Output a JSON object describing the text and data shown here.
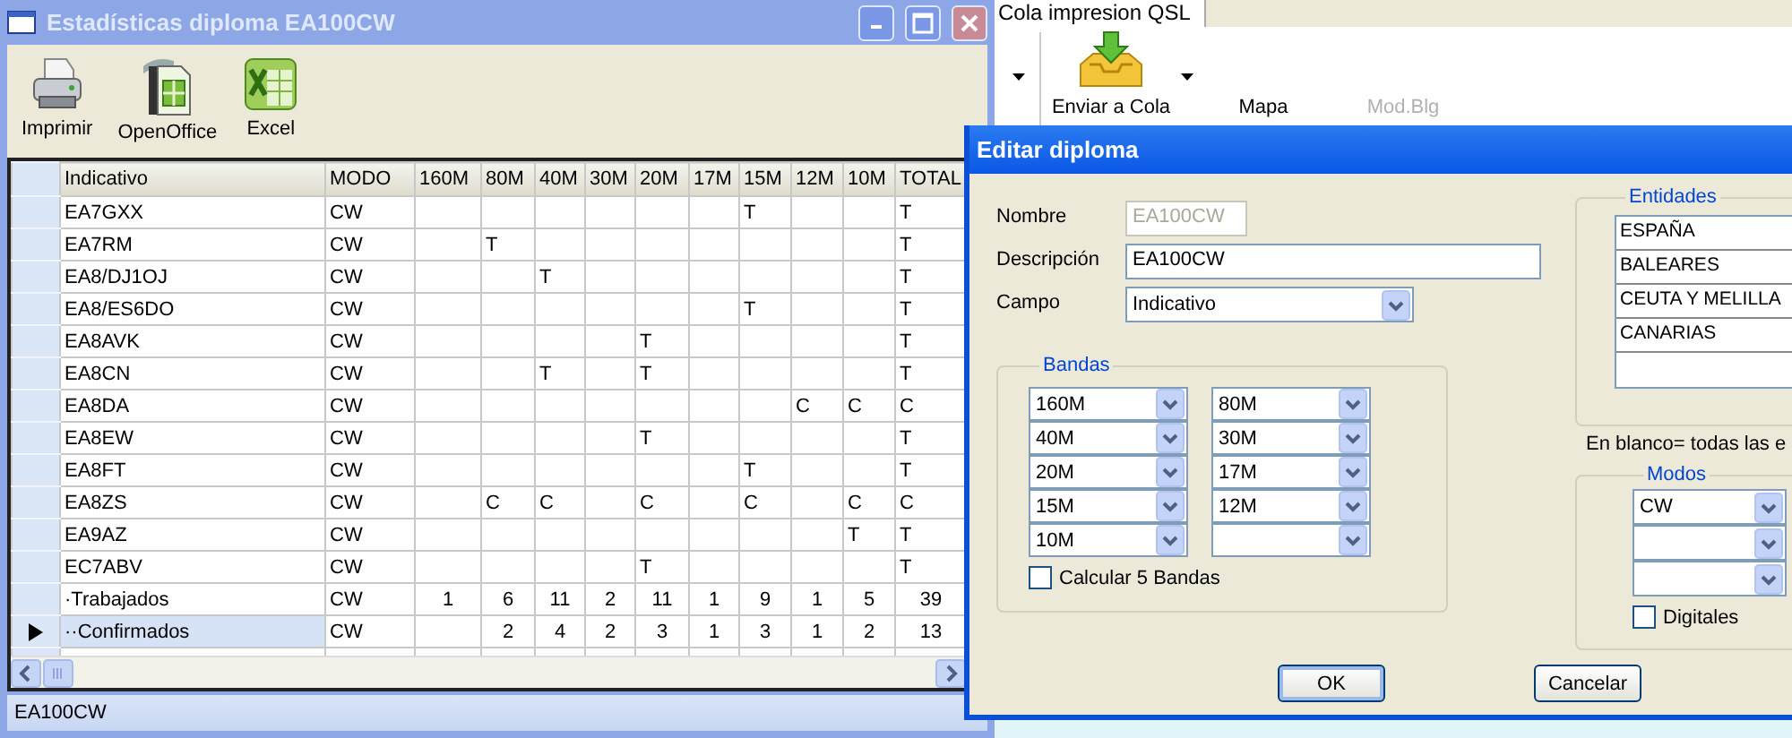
{
  "stats_window": {
    "title": "Estadísticas diploma EA100CW",
    "toolbar": [
      {
        "label": "Imprimir",
        "kind": "printer"
      },
      {
        "label": "OpenOffice",
        "kind": "openoffice"
      },
      {
        "label": "Excel",
        "kind": "excel"
      }
    ],
    "table": {
      "columns": [
        "Indicativo",
        "MODO",
        "160M",
        "80M",
        "40M",
        "30M",
        "20M",
        "17M",
        "15M",
        "12M",
        "10M",
        "TOTAL"
      ],
      "rows": [
        {
          "kind": "call",
          "selected": false,
          "cells": [
            "EA7GXX",
            "CW",
            null,
            null,
            null,
            null,
            null,
            null,
            "T",
            null,
            null,
            "T"
          ]
        },
        {
          "kind": "call",
          "selected": false,
          "cells": [
            "EA7RM",
            "CW",
            null,
            "T",
            null,
            null,
            null,
            null,
            null,
            null,
            null,
            "T"
          ]
        },
        {
          "kind": "call",
          "selected": false,
          "cells": [
            "EA8/DJ1OJ",
            "CW",
            null,
            null,
            "T",
            null,
            null,
            null,
            null,
            null,
            null,
            "T"
          ]
        },
        {
          "kind": "call",
          "selected": false,
          "cells": [
            "EA8/ES6DO",
            "CW",
            null,
            null,
            null,
            null,
            null,
            null,
            "T",
            null,
            null,
            "T"
          ]
        },
        {
          "kind": "call",
          "selected": false,
          "cells": [
            "EA8AVK",
            "CW",
            null,
            null,
            null,
            null,
            "T",
            null,
            null,
            null,
            null,
            "T"
          ]
        },
        {
          "kind": "call",
          "selected": false,
          "cells": [
            "EA8CN",
            "CW",
            null,
            null,
            "T",
            null,
            "T",
            null,
            null,
            null,
            null,
            "T"
          ]
        },
        {
          "kind": "call",
          "selected": false,
          "cells": [
            "EA8DA",
            "CW",
            null,
            null,
            null,
            null,
            null,
            null,
            null,
            "C",
            "C",
            "C"
          ]
        },
        {
          "kind": "call",
          "selected": false,
          "cells": [
            "EA8EW",
            "CW",
            null,
            null,
            null,
            null,
            "T",
            null,
            null,
            null,
            null,
            "T"
          ]
        },
        {
          "kind": "call",
          "selected": false,
          "cells": [
            "EA8FT",
            "CW",
            null,
            null,
            null,
            null,
            null,
            null,
            "T",
            null,
            null,
            "T"
          ]
        },
        {
          "kind": "call",
          "selected": false,
          "cells": [
            "EA8ZS",
            "CW",
            null,
            "C",
            "C",
            null,
            "C",
            null,
            "C",
            null,
            "C",
            "C"
          ]
        },
        {
          "kind": "call",
          "selected": false,
          "cells": [
            "EA9AZ",
            "CW",
            null,
            null,
            null,
            null,
            null,
            null,
            null,
            null,
            "T",
            "T"
          ]
        },
        {
          "kind": "call",
          "selected": false,
          "cells": [
            "EC7ABV",
            "CW",
            null,
            null,
            null,
            null,
            "T",
            null,
            null,
            null,
            null,
            "T"
          ]
        },
        {
          "kind": "total",
          "selected": false,
          "cells": [
            "·Trabajados",
            "CW",
            "1",
            "6",
            "11",
            "2",
            "11",
            "1",
            "9",
            "1",
            "5",
            "39"
          ]
        },
        {
          "kind": "total",
          "selected": true,
          "cells": [
            "··Confirmados",
            "CW",
            null,
            "2",
            "4",
            "2",
            "3",
            "1",
            "3",
            "1",
            "2",
            "13"
          ]
        }
      ]
    },
    "status_bar": "EA100CW"
  },
  "qsl_window": {
    "tab": "Cola impresion QSL",
    "toolbar": [
      {
        "label": "Enviar a Cola",
        "kind": "inbox",
        "disabled": false
      },
      {
        "label": "Mapa",
        "kind": "plain",
        "disabled": false
      },
      {
        "label": "Mod.Blg",
        "kind": "plain",
        "disabled": true
      }
    ]
  },
  "dialog": {
    "title": "Editar diploma",
    "fields": [
      {
        "label": "Nombre",
        "value": "EA100CW",
        "kind": "text",
        "disabled": true
      },
      {
        "label": "Descripción",
        "value": "EA100CW",
        "kind": "text",
        "disabled": false
      },
      {
        "label": "Campo",
        "value": "Indicativo",
        "kind": "select"
      }
    ],
    "bandas": {
      "title": "Bandas",
      "selects": [
        {
          "value": "160M"
        },
        {
          "value": "80M"
        },
        {
          "value": "40M"
        },
        {
          "value": "30M"
        },
        {
          "value": "20M"
        },
        {
          "value": "17M"
        },
        {
          "value": "15M"
        },
        {
          "value": "12M"
        },
        {
          "value": "10M"
        }
      ],
      "checkbox": {
        "label": "Calcular 5 Bandas",
        "checked": false
      }
    },
    "entidades": {
      "title": "Entidades",
      "items": [
        {
          "label": "ESPAÑA"
        },
        {
          "label": "BALEARES"
        },
        {
          "label": "CEUTA Y MELILLA"
        },
        {
          "label": "CANARIAS"
        }
      ],
      "hint": "En blanco= todas las e"
    },
    "modos": {
      "title": "Modos",
      "selects": [
        {
          "value": "CW"
        }
      ],
      "checkbox": {
        "label": "Digitales",
        "checked": false
      }
    },
    "buttons": [
      {
        "label": "OK",
        "kind": "default"
      },
      {
        "label": "Cancelar",
        "kind": "normal"
      }
    ]
  }
}
